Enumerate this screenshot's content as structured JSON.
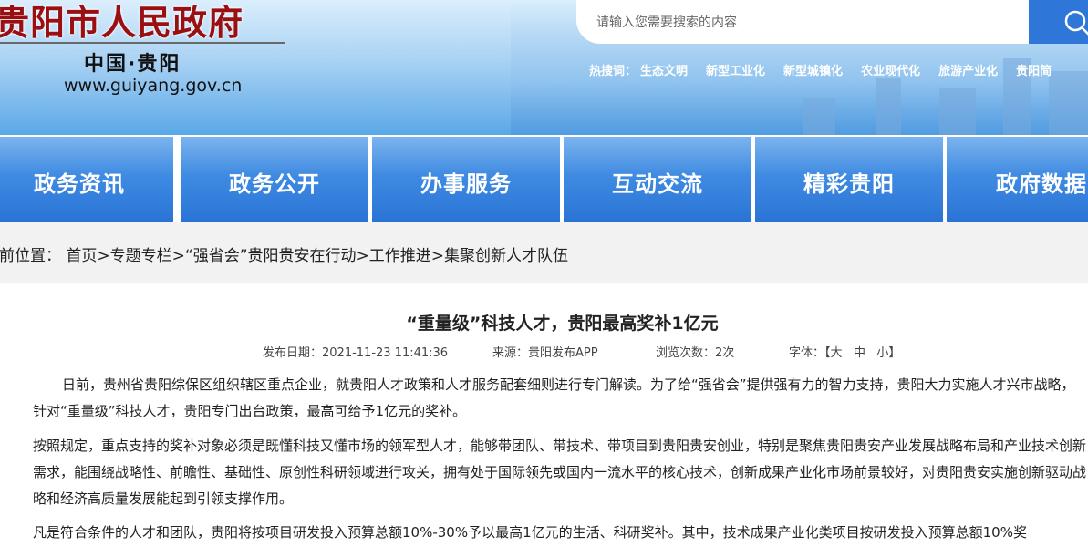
{
  "header": {
    "logo_title": "贵阳市人民政府",
    "logo_subtitle": "中国·贵阳",
    "logo_url": "www.guiyang.gov.cn",
    "search_placeholder": "请输入您需要搜索的内容",
    "search_icon": "search-icon",
    "hot_label": "热搜词：",
    "hot_terms": [
      "生态文明",
      "新型工业化",
      "新型城镇化",
      "农业现代化",
      "旅游产业化",
      "贵阳简"
    ]
  },
  "nav": {
    "items": [
      "政务资讯",
      "政务公开",
      "办事服务",
      "互动交流",
      "精彩贵阳",
      "政府数据"
    ]
  },
  "breadcrumb": {
    "text": "当前位置： 首页>专题专栏>“强省会”贵阳贵安在行动>工作推进>集聚创新人才队伍"
  },
  "article": {
    "title": "“重量级”科技人才，贵阳最高奖补1亿元",
    "date": "发布日期：2021-11-23 11:41:36",
    "source": "来源：贵阳发布APP",
    "views": "浏览次数：2次",
    "font_label": "字体：【",
    "font_large": "大",
    "font_medium": "中",
    "font_small": "小",
    "font_close": "】",
    "paragraphs": [
      "日前，贵州省贵阳综保区组织辖区重点企业，就贵阳人才政策和人才服务配套细则进行专门解读。为了给“强省会”提供强有力的智力支持，贵阳大力实施人才兴市战略，针对“重量级”科技人才，贵阳专门出台政策，最高可给予1亿元的奖补。",
      "按照规定，重点支持的奖补对象必须是既懂科技又懂市场的领军型人才，能够带团队、带技术、带项目到贵阳贵安创业，特别是聚焦贵阳贵安产业发展战略布局和产业技术创新需求，能围绕战略性、前瞻性、基础性、原创性科研领域进行攻关，拥有处于国际领先或国内一流水平的核心技术，创新成果产业化市场前景较好，对贵阳贵安实施创新驱动战略和经济高质量发展能起到引领支撑作用。",
      "凡是符合条件的人才和团队，贵阳将按项目研发投入预算总额10%-30%予以最高1亿元的生活、科研奖补。其中，技术成果产业化类项目按研发投入预算总额10%奖"
    ]
  },
  "colors": {
    "logo_red": "#9a0f12",
    "nav_blue": "#2a73d6",
    "search_button": "#2f76d9"
  }
}
